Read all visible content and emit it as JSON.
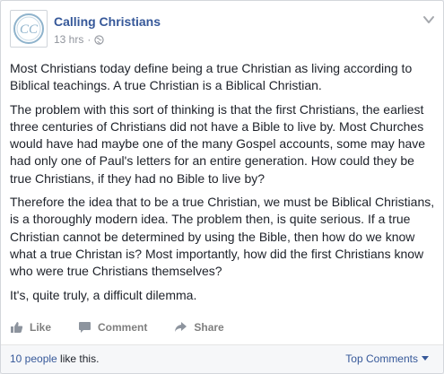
{
  "post": {
    "author": "Calling Christians",
    "timestamp": "13 hrs",
    "separator": "·",
    "privacy_icon": "globe-icon",
    "avatar_monogram": "CC",
    "paragraphs": [
      "Most Christians today define being a true Christian as living according to Biblical teachings. A true Christian is a Biblical Christian.",
      "The problem with this sort of thinking is that the first Christians, the earliest three centuries of Christians did not have a Bible to live by. Most Churches would have had maybe one of the many Gospel accounts, some may have had only one of Paul's letters for an entire generation. How could they be true Christians, if they had no Bible to live by?",
      "Therefore the idea that to be a true Christian, we must be Biblical Christians, is a thoroughly modern idea. The problem then, is quite serious. If a true Christian cannot be determined by using the Bible, then how do we know what a true Christan is? Most importantly, how did the first Christians know who were true Christians themselves?",
      "It's, quite truly, a difficult dilemma."
    ]
  },
  "actions": {
    "like_label": "Like",
    "comment_label": "Comment",
    "share_label": "Share"
  },
  "footer": {
    "likes_count_link": "10 people",
    "likes_suffix": " like this.",
    "sort_label": "Top Comments"
  },
  "colors": {
    "link": "#365899",
    "meta": "#90949c",
    "text": "#1d2129",
    "action": "#7f7f7f",
    "logo_blue": "#8fb3cc"
  }
}
